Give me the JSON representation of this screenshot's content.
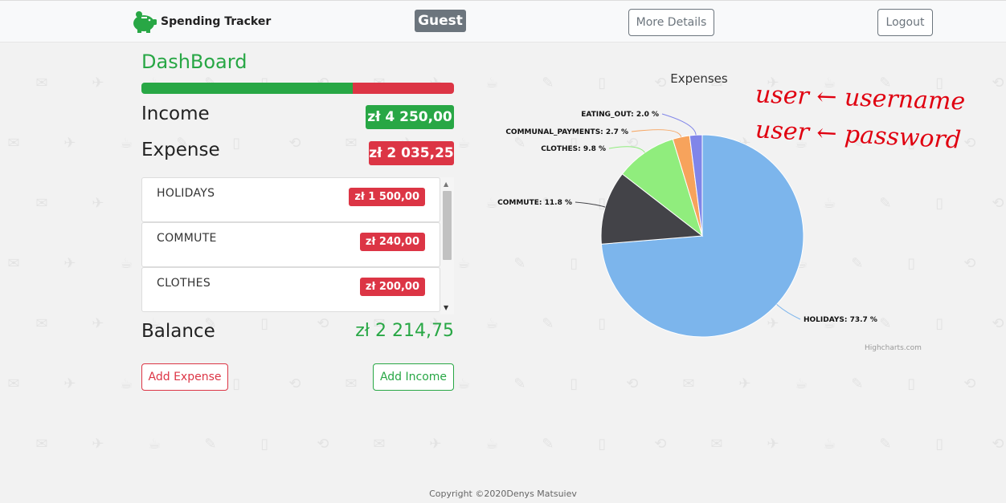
{
  "app": {
    "brand_name": "Spending Tracker",
    "brand_icon": "piggy-bank-icon",
    "user_badge": "Guest",
    "more_details_label": "More Details",
    "logout_label": "Logout"
  },
  "dashboard": {
    "title": "DashBoard",
    "progress": {
      "income_fraction": 0.676,
      "income_color": "#28a745",
      "expense_color": "#dc3545"
    },
    "income_label": "Income",
    "income_amount": "zł 4 250,00",
    "expense_label": "Expense",
    "expense_amount": "zł 2 035,25",
    "expense_items": [
      {
        "name": "HOLIDAYS",
        "amount": "zł 1 500,00"
      },
      {
        "name": "COMMUTE",
        "amount": "zł 240,00"
      },
      {
        "name": "CLOTHES",
        "amount": "zł 200,00"
      }
    ],
    "balance_label": "Balance",
    "balance_amount": "zł 2 214,75",
    "add_expense_label": "Add Expense",
    "add_income_label": "Add Income"
  },
  "chart_data": {
    "type": "pie",
    "title": "Expenses",
    "slices": [
      {
        "label": "HOLIDAYS: 73.7 %",
        "value": 73.7,
        "color": "#7cb5ec"
      },
      {
        "label": "COMMUTE: 11.8 %",
        "value": 11.8,
        "color": "#434348"
      },
      {
        "label": "CLOTHES: 9.8 %",
        "value": 9.8,
        "color": "#90ed7d"
      },
      {
        "label": "COMMUNAL_PAYMENTS: 2.7 %",
        "value": 2.7,
        "color": "#f7a35c"
      },
      {
        "label": "EATING_OUT: 2.0 %",
        "value": 2.0,
        "color": "#8085e9"
      }
    ],
    "credits": "Highcharts.com"
  },
  "annotation": {
    "line1": "user ← username",
    "line2": "user ← password",
    "color": "#e00010"
  },
  "footer": {
    "copyright": "Copyright ©2020Denys Matsuiev"
  }
}
